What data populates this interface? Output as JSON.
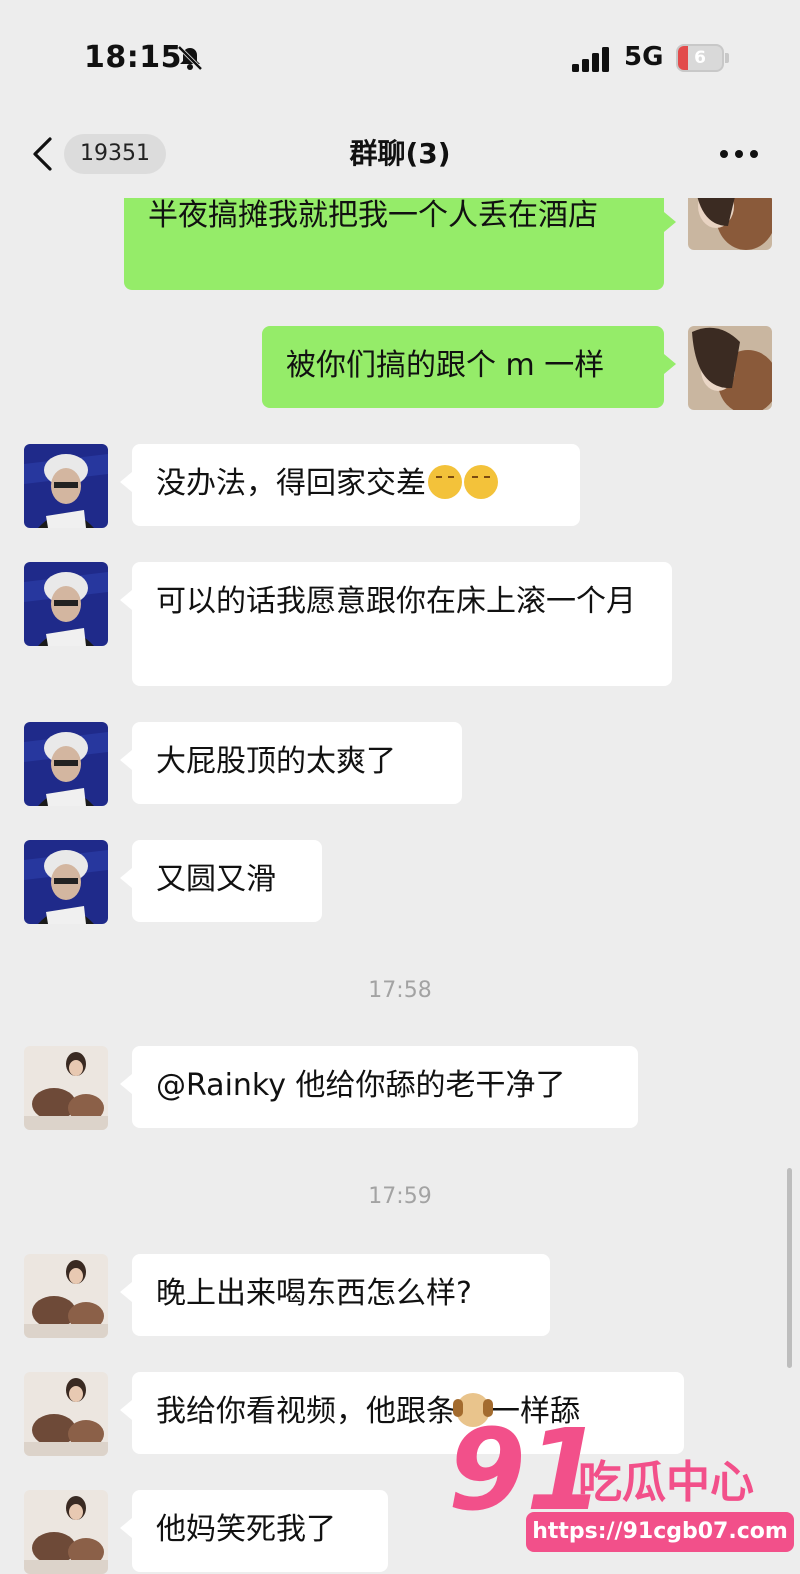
{
  "status_bar": {
    "time": "18:15",
    "network": "5G",
    "battery": "6"
  },
  "nav": {
    "unread_count": "19351",
    "title": "群聊(3)"
  },
  "messages": [
    {
      "text": "半夜搞摊我就把我一个人丢在酒店"
    },
    {
      "text": "被你们搞的跟个 m 一样"
    },
    {
      "text": "没办法，得回家交差"
    },
    {
      "text": "可以的话我愿意跟你在床上滚一个月"
    },
    {
      "text": "大屁股顶的太爽了"
    },
    {
      "text": "又圆又滑"
    },
    {
      "text": "@Rainky 他给你舔的老干净了"
    },
    {
      "text_before": "我给你看视频，他跟条",
      "text_after": "一样舔"
    },
    {
      "text": "晚上出来喝东西怎么样?"
    },
    {
      "text": "他妈笑死我了"
    }
  ],
  "times": [
    "17:58",
    "17:59"
  ],
  "watermark": {
    "number": "91",
    "brand": "吃瓜中心",
    "url": "https://91cgb07.com"
  },
  "icons": [
    "bell-slash-icon",
    "signal-bars-icon",
    "back-chevron-icon",
    "more-dots-icon",
    "crying-emoji-icon",
    "dog-emoji-icon"
  ]
}
